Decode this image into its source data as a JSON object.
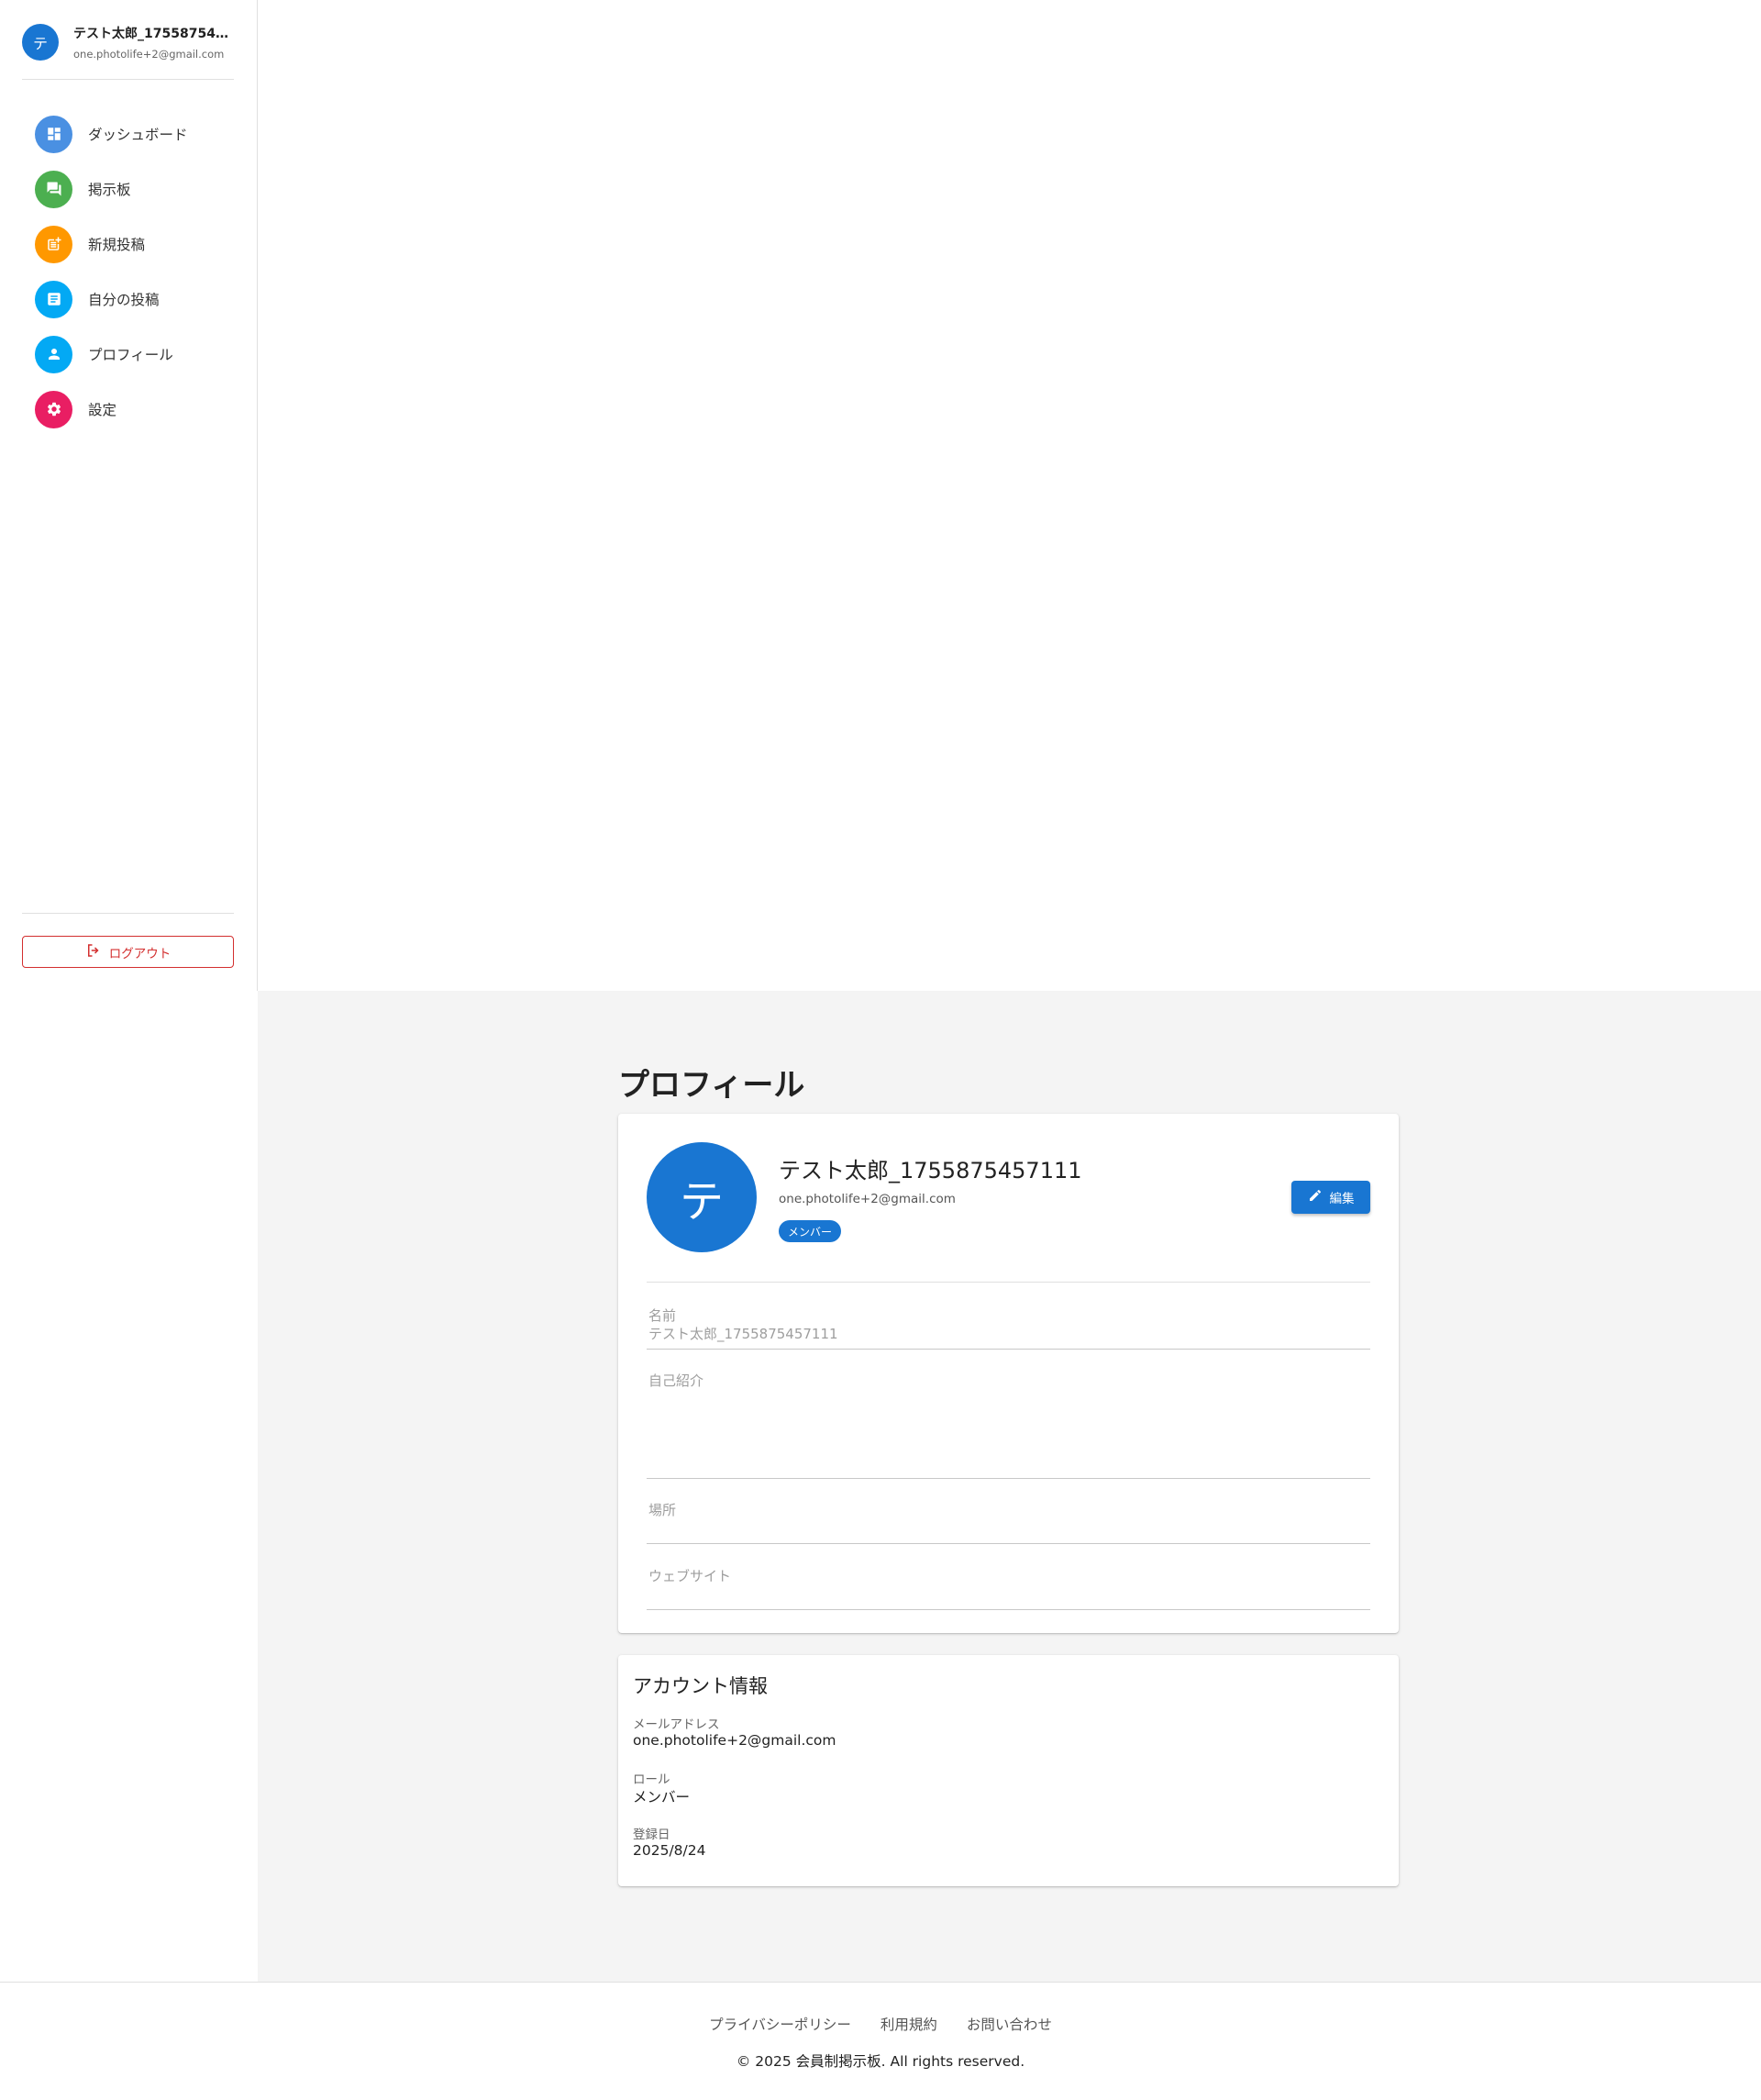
{
  "user": {
    "avatar_initial": "テ",
    "name": "テスト太郎_1755875457...",
    "email": "one.photolife+2@gmail.com"
  },
  "nav": {
    "items": [
      {
        "label": "ダッシュボード",
        "icon": "dashboard-icon",
        "color": "#4a90e2"
      },
      {
        "label": "掲示板",
        "icon": "forum-icon",
        "color": "#4caf50"
      },
      {
        "label": "新規投稿",
        "icon": "post-add-icon",
        "color": "#ff9800"
      },
      {
        "label": "自分の投稿",
        "icon": "article-icon",
        "color": "#03a9f4"
      },
      {
        "label": "プロフィール",
        "icon": "person-icon",
        "color": "#03a9f4"
      },
      {
        "label": "設定",
        "icon": "settings-icon",
        "color": "#e91e63"
      }
    ]
  },
  "logout_label": "ログアウト",
  "page_title": "プロフィール",
  "profile": {
    "avatar_initial": "テ",
    "name": "テスト太郎_1755875457111",
    "email": "one.photolife+2@gmail.com",
    "role_chip": "メンバー",
    "edit_label": "編集",
    "fields": {
      "name_label": "名前",
      "name_value": "テスト太郎_1755875457111",
      "bio_label": "自己紹介",
      "location_label": "場所",
      "website_label": "ウェブサイト"
    }
  },
  "account": {
    "title": "アカウント情報",
    "email_label": "メールアドレス",
    "email_value": "one.photolife+2@gmail.com",
    "role_label": "ロール",
    "role_value": "メンバー",
    "registered_label": "登録日",
    "registered_value": "2025/8/24"
  },
  "footer": {
    "links": [
      "プライバシーポリシー",
      "利用規約",
      "お問い合わせ"
    ],
    "copyright": "© 2025 会員制掲示板. All rights reserved."
  },
  "colors": {
    "primary": "#1976d2",
    "logout": "#d32f2f",
    "main_bg": "#f4f4f4"
  }
}
